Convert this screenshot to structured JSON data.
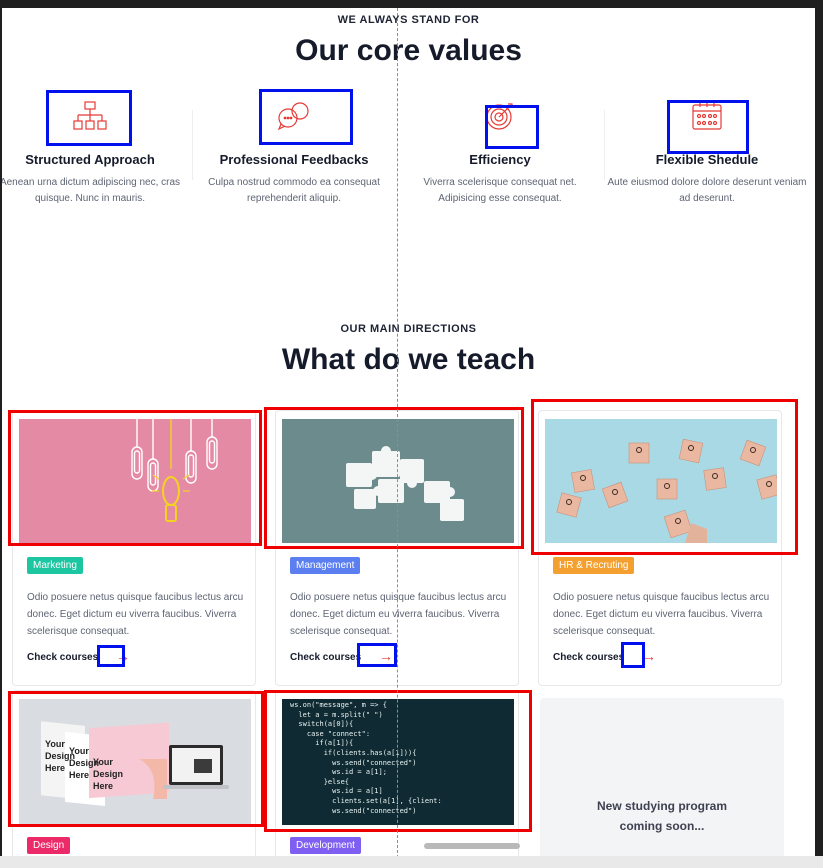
{
  "values_section": {
    "eyebrow": "WE ALWAYS STAND FOR",
    "title": "Our core values",
    "items": [
      {
        "icon": "hierarchy-icon",
        "title": "Structured Approach",
        "desc": "Aenean urna dictum adipiscing nec, cras quisque. Nunc in mauris."
      },
      {
        "icon": "chat-bubbles-icon",
        "title": "Professional Feedbacks",
        "desc": "Culpa nostrud commodo ea consequat reprehenderit aliquip."
      },
      {
        "icon": "target-icon",
        "title": "Efficiency",
        "desc": "Viverra scelerisque consequat net. Adipisicing esse consequat."
      },
      {
        "icon": "calendar-icon",
        "title": "Flexible Shedule",
        "desc": "Aute eiusmod dolore dolore deserunt veniam ad deserunt."
      }
    ]
  },
  "teach_section": {
    "eyebrow": "OUR MAIN DIRECTIONS",
    "title": "What do we teach",
    "cards": [
      {
        "tag": "Marketing",
        "tag_color": "#1cc6a0",
        "desc": "Odio posuere netus quisque faucibus lectus arcu donec. Eget dictum eu viverra faucibus. Viverra scelerisque consequat.",
        "link": "Check courses"
      },
      {
        "tag": "Management",
        "tag_color": "#5b7ff0",
        "desc": "Odio posuere netus quisque faucibus lectus arcu donec. Eget dictum eu viverra faucibus. Viverra scelerisque consequat.",
        "link": "Check courses"
      },
      {
        "tag": "HR & Recruting",
        "tag_color": "#f4a030",
        "desc": "Odio posuere netus quisque faucibus lectus arcu donec. Eget dictum eu viverra faucibus. Viverra scelerisque consequat.",
        "link": "Check courses"
      },
      {
        "tag": "Design",
        "tag_color": "#ec2a69"
      },
      {
        "tag": "Development",
        "tag_color": "#7e5ff2"
      }
    ],
    "soon_line1": "New studying program",
    "soon_line2": "coming soon..."
  },
  "mock_text": {
    "your": "Your",
    "design": "Design",
    "here": "Here"
  },
  "code_lines": [
    "ws.on(\"message\", m => {",
    "  let a = m.split(\" \")",
    "  switch(a[0]){",
    "    case \"connect\":",
    "      if(a[1]){",
    "        if(clients.has(a[1])){",
    "          ws.send(\"connected\")",
    "          ws.id = a[1];",
    "        }else{",
    "          ws.id = a[1]",
    "          clients.set(a[1], {client:",
    "          ws.send(\"connected\")"
  ],
  "colors": {
    "accent_red": "#e53935",
    "highlight_blue": "#0011ee",
    "highlight_red": "#ee0000"
  }
}
